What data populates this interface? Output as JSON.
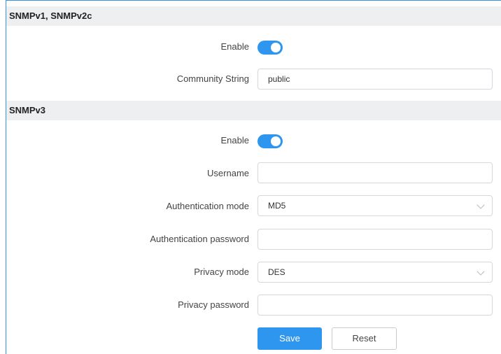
{
  "sections": {
    "v1v2c": {
      "title": "SNMPv1, SNMPv2c",
      "enable_label": "Enable",
      "enable_on": true,
      "community_label": "Community String",
      "community_value": "public"
    },
    "v3": {
      "title": "SNMPv3",
      "enable_label": "Enable",
      "enable_on": true,
      "username_label": "Username",
      "username_value": "",
      "auth_mode_label": "Authentication mode",
      "auth_mode_value": "MD5",
      "auth_password_label": "Authentication password",
      "auth_password_value": "",
      "privacy_mode_label": "Privacy mode",
      "privacy_mode_value": "DES",
      "privacy_password_label": "Privacy password",
      "privacy_password_value": ""
    }
  },
  "actions": {
    "save_label": "Save",
    "reset_label": "Reset"
  },
  "colors": {
    "accent": "#2e96ef",
    "header_bg": "#eeeff1",
    "frame_border": "#3a8fe6"
  }
}
